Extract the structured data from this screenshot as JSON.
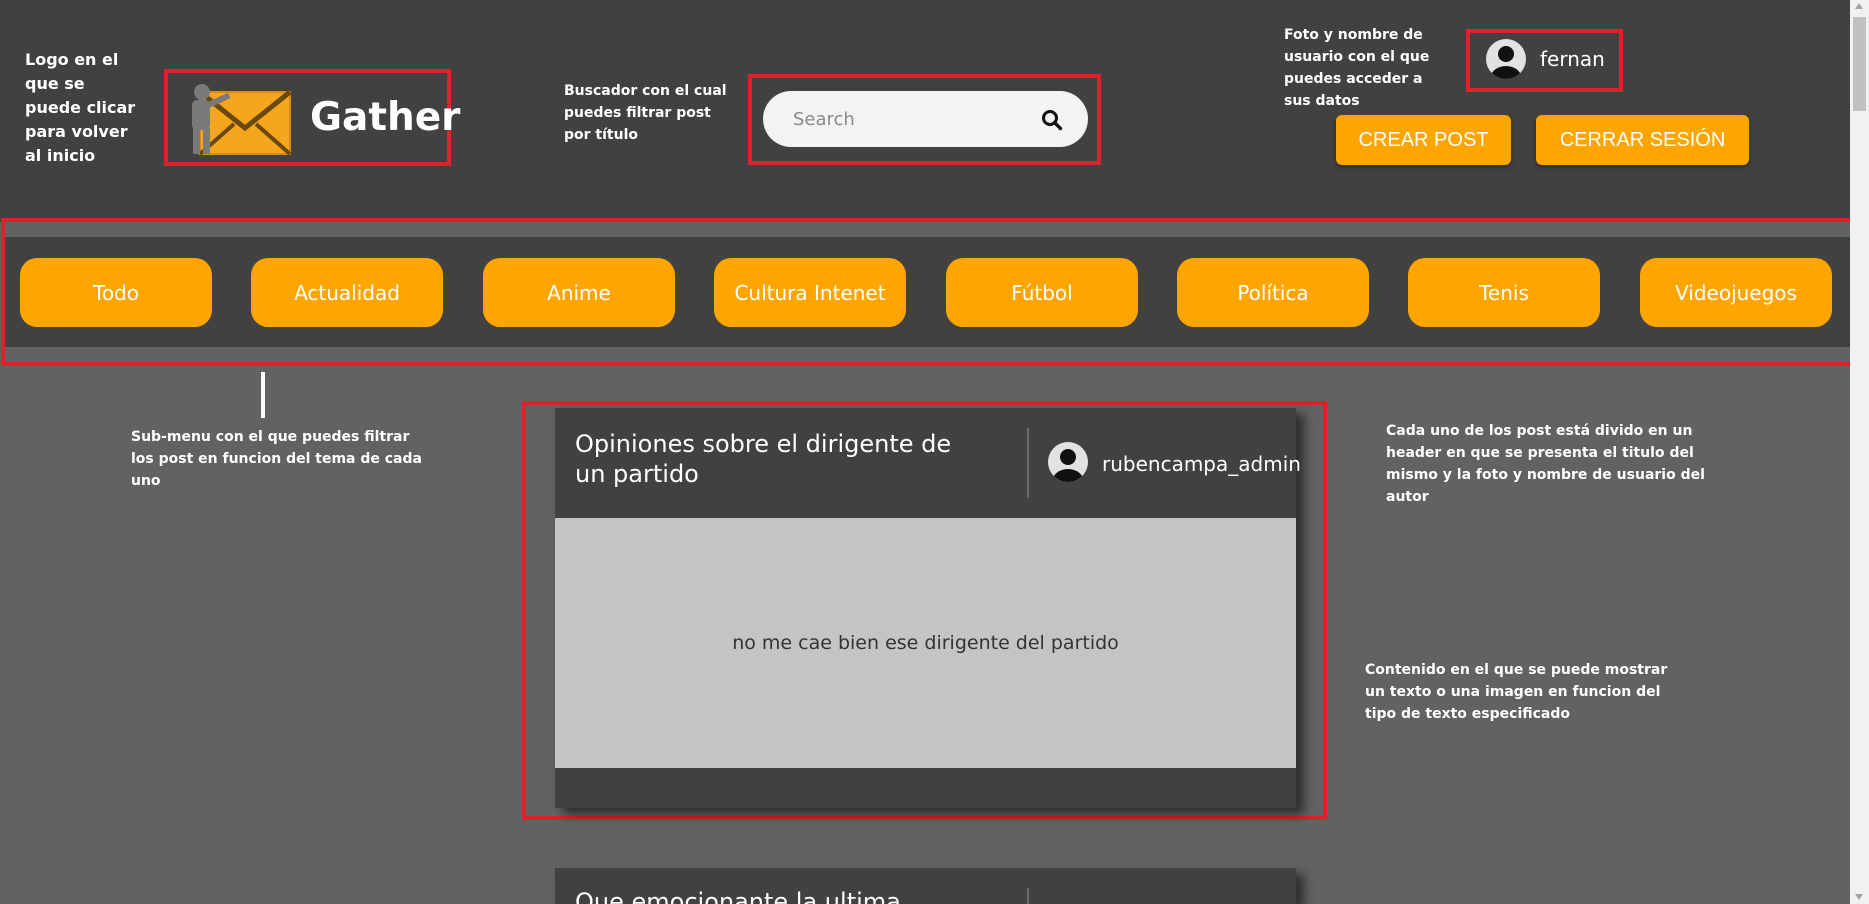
{
  "header": {
    "logo_text": "Gather",
    "search_placeholder": "Search",
    "username": "fernan",
    "create_post_label": "CREAR POST",
    "logout_label": "CERRAR SESIÓN"
  },
  "annotations": {
    "logo": "Logo en el que se puede clicar para volver al inicio",
    "search": "Buscador con el cual puedes filtrar post por título",
    "user": "Foto y nombre de usuario con el que puedes acceder a sus datos",
    "submenu": "Sub-menu con el que puedes filtrar los post en funcion del tema de cada uno",
    "post_header": "Cada uno de los post está divido en un header en que se presenta el titulo del mismo y la foto y nombre de usuario del autor",
    "post_content": "Contenido en el que se puede mostrar un texto o una imagen en funcion del tipo de texto especificado"
  },
  "categories": [
    "Todo",
    "Actualidad",
    "Anime",
    "Cultura Intenet",
    "Fútbol",
    "Política",
    "Tenis",
    "Videojuegos"
  ],
  "posts": [
    {
      "title": "Opiniones sobre el dirigente de un partido",
      "author": "rubencampa_admin",
      "content": "no me cae bien ese dirigente del partido"
    },
    {
      "title": "Que emocionante la ultima"
    }
  ],
  "colors": {
    "accent": "#ffa500",
    "header_bg": "#414141",
    "page_bg": "#626262",
    "annotation_box": "#e0202a"
  }
}
